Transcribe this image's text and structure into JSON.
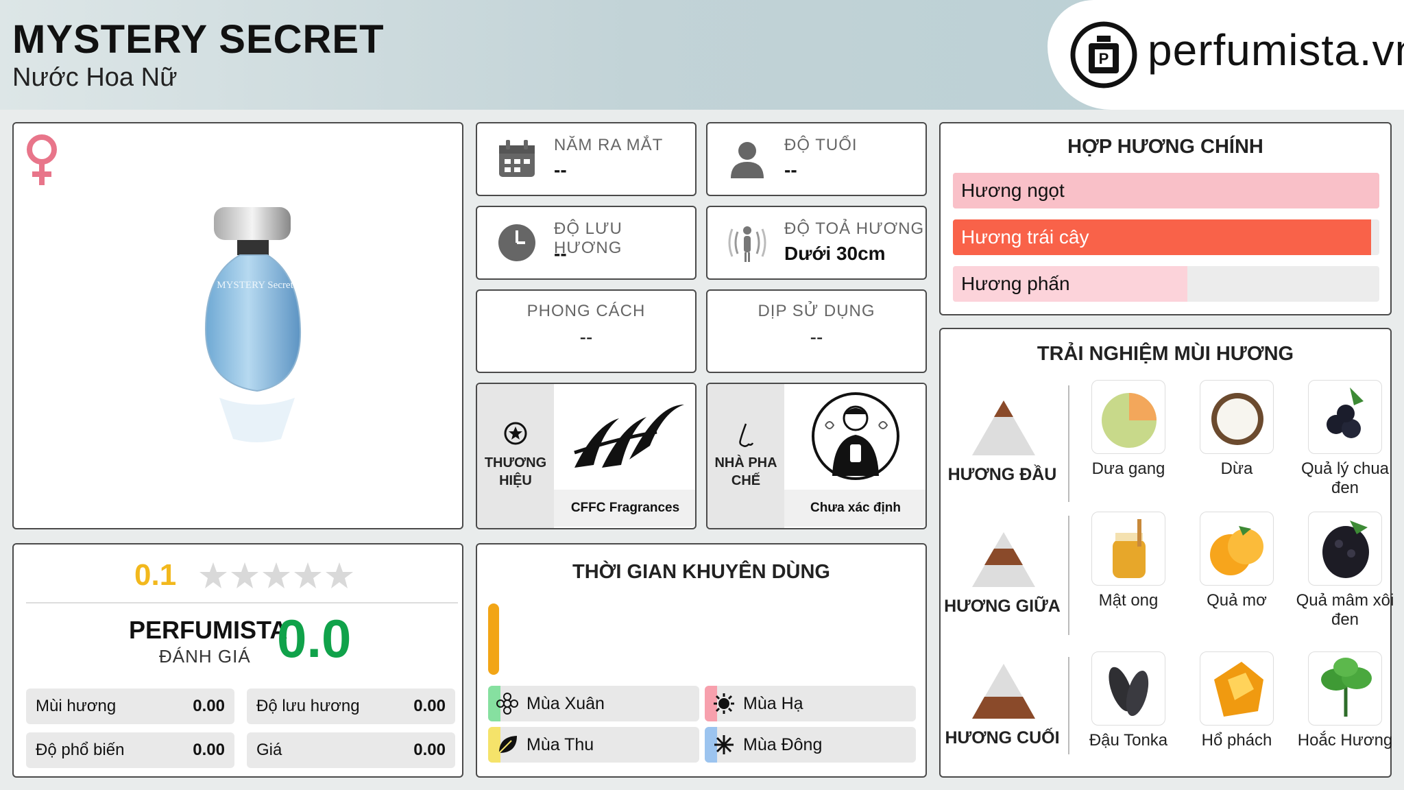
{
  "header": {
    "title": "MYSTERY SECRET",
    "subtitle": "Nước Hoa Nữ",
    "logo_text": "perfumista.vn"
  },
  "product": {
    "gender_icon": "female-icon",
    "bottle_label": "MYSTERY Secret"
  },
  "info": {
    "launch_year": {
      "label": "NĂM RA MẮT",
      "value": "--",
      "icon": "calendar-icon"
    },
    "age": {
      "label": "ĐỘ TUỔI",
      "value": "--",
      "icon": "person-icon"
    },
    "longevity": {
      "label": "ĐỘ LƯU HƯƠNG",
      "value": "--",
      "icon": "clock-icon"
    },
    "sillage": {
      "label": "ĐỘ TOẢ HƯƠNG",
      "value": "Dưới 30cm",
      "icon": "sillage-icon"
    },
    "style": {
      "label": "PHONG CÁCH",
      "value": "--"
    },
    "occasion": {
      "label": "DỊP SỬ DỤNG",
      "value": "--"
    }
  },
  "brand": {
    "label_line1": "THƯƠNG",
    "label_line2": "HIỆU",
    "name": "CFFC Fragrances"
  },
  "perfumer": {
    "label_line1": "NHÀ PHA",
    "label_line2": "CHẾ",
    "name": "Chưa xác định"
  },
  "accords": {
    "title": "HỢP HƯƠNG CHÍNH",
    "items": [
      {
        "label": "Hương ngọt",
        "fraction": 1.0,
        "color": "#f9c0c8"
      },
      {
        "label": "Hương trái cây",
        "fraction": 0.98,
        "color": "#f96249"
      },
      {
        "label": "Hương phấn",
        "fraction": 0.55,
        "color": "#fcd3da"
      }
    ]
  },
  "notes": {
    "title": "TRẢI NGHIỆM MÙI HƯƠNG",
    "top": {
      "label": "HƯƠNG ĐẦU",
      "items": [
        "Dưa gang",
        "Dừa",
        "Quả lý chua đen"
      ]
    },
    "middle": {
      "label": "HƯƠNG GIỮA",
      "items": [
        "Mật ong",
        "Quả mơ",
        "Quả mâm xôi đen"
      ]
    },
    "base": {
      "label": "HƯƠNG CUỐI",
      "items": [
        "Đậu Tonka",
        "Hổ phách",
        "Hoắc Hương"
      ]
    }
  },
  "rating": {
    "score": "0.1",
    "stars_filled": 0.02,
    "pf_label": "PERFUMISTA",
    "pf_sub": "ĐÁNH GIÁ",
    "pf_score": "0.0",
    "metrics": [
      {
        "label": "Mùi hương",
        "value": "0.00"
      },
      {
        "label": "Độ lưu hương",
        "value": "0.00"
      },
      {
        "label": "Độ phổ biến",
        "value": "0.00"
      },
      {
        "label": "Giá",
        "value": "0.00"
      }
    ]
  },
  "time": {
    "title": "THỜI GIAN KHUYÊN DÙNG",
    "seasons": [
      {
        "label": "Mùa Xuân",
        "color": "#86e0a0",
        "icon": "flower-icon"
      },
      {
        "label": "Mùa Hạ",
        "color": "#f7a0ad",
        "icon": "sun-icon"
      },
      {
        "label": "Mùa Thu",
        "color": "#f5e36a",
        "icon": "leaf-icon"
      },
      {
        "label": "Mùa Đông",
        "color": "#9cc4ef",
        "icon": "snowflake-icon"
      }
    ]
  }
}
